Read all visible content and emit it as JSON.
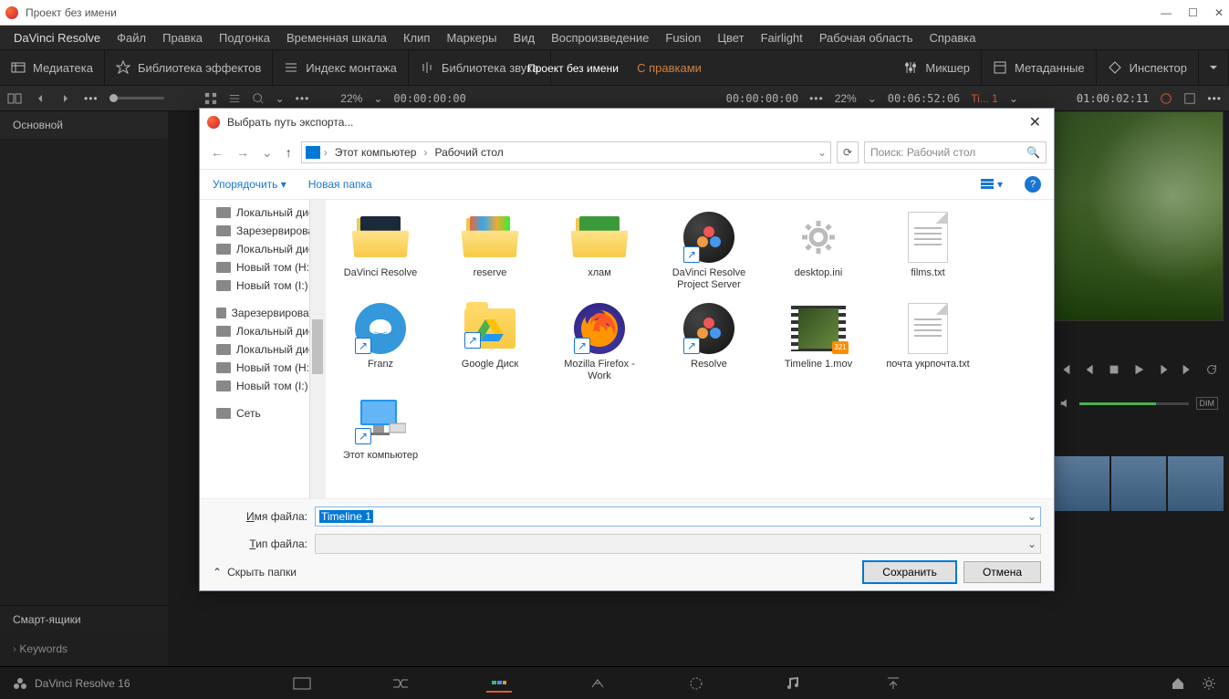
{
  "window": {
    "title": "Проект без имени",
    "minimize": "—",
    "maximize": "☐",
    "close": "✕"
  },
  "menubar": [
    "DaVinci Resolve",
    "Файл",
    "Правка",
    "Подгонка",
    "Временная шкала",
    "Клип",
    "Маркеры",
    "Вид",
    "Воспроизведение",
    "Fusion",
    "Цвет",
    "Fairlight",
    "Рабочая область",
    "Справка"
  ],
  "toolbar": {
    "media": "Медиатека",
    "effects": "Библиотека эффектов",
    "index": "Индекс монтажа",
    "soundlib": "Библиотека звука",
    "project_name": "Проект без имени",
    "modified": "С правками",
    "mixer": "Микшер",
    "metadata": "Метаданные",
    "inspector": "Инспектор"
  },
  "infobar": {
    "dots": "•••",
    "zoom1": "22%",
    "tc1": "00:00:00:00",
    "tc2": "00:00:00:00",
    "zoom2": "22%",
    "tc3": "00:06:52:06",
    "tl": "Ti... 1",
    "tc4": "01:00:02:11"
  },
  "left_panel": {
    "main": "Основной",
    "smart": "Смарт-ящики",
    "keywords": "Keywords"
  },
  "vol_dim": "DIM",
  "bottom": {
    "brand": "DaVinci Resolve 16"
  },
  "dialog": {
    "title": "Выбрать путь экспорта...",
    "close": "✕",
    "breadcrumb": {
      "pc": "Этот компьютер",
      "desk": "Рабочий стол"
    },
    "search_placeholder": "Поиск: Рабочий стол",
    "organize": "Упорядочить ▾",
    "new_folder": "Новая папка",
    "help": "?",
    "tree": [
      "Локальный диск",
      "Зарезервирован",
      "Локальный диск",
      "Новый том (H:)",
      "Новый том (I:)",
      "Зарезервировано",
      "Локальный диск",
      "Локальный диск",
      "Новый том (H:)",
      "Новый том (I:)",
      "Сеть"
    ],
    "files": [
      {
        "label": "DaVinci Resolve",
        "icon": "folder-open",
        "thumb": "#1a2a3a"
      },
      {
        "label": "reserve",
        "icon": "folder-open",
        "thumb": "linear-gradient(90deg,#e63,#3ae,#ea3,#3e3)"
      },
      {
        "label": "хлам",
        "icon": "folder-open",
        "thumb": "#3a9a3a"
      },
      {
        "label": "DaVinci Resolve Project Server",
        "icon": "resolve-circle",
        "shortcut": true
      },
      {
        "label": "desktop.ini",
        "icon": "gear"
      },
      {
        "label": "films.txt",
        "icon": "doc"
      },
      {
        "label": "Franz",
        "icon": "franz",
        "shortcut": true
      },
      {
        "label": "Google Диск",
        "icon": "gdrive",
        "shortcut": true
      },
      {
        "label": "Mozilla Firefox - Work",
        "icon": "firefox",
        "shortcut": true
      },
      {
        "label": "Resolve",
        "icon": "resolve-circle",
        "shortcut": true
      },
      {
        "label": "Timeline 1.mov",
        "icon": "video"
      },
      {
        "label": "почта укрпочта.txt",
        "icon": "doc"
      },
      {
        "label": "Этот компьютер",
        "icon": "computer",
        "shortcut": true
      }
    ],
    "filename_label": "Имя файла:",
    "filename_u": "И",
    "filename_value": "Timeline 1",
    "type_label": "Тип файла:",
    "type_u": "Т",
    "hide": "Скрыть папки",
    "save": "Сохранить",
    "cancel": "Отмена"
  }
}
